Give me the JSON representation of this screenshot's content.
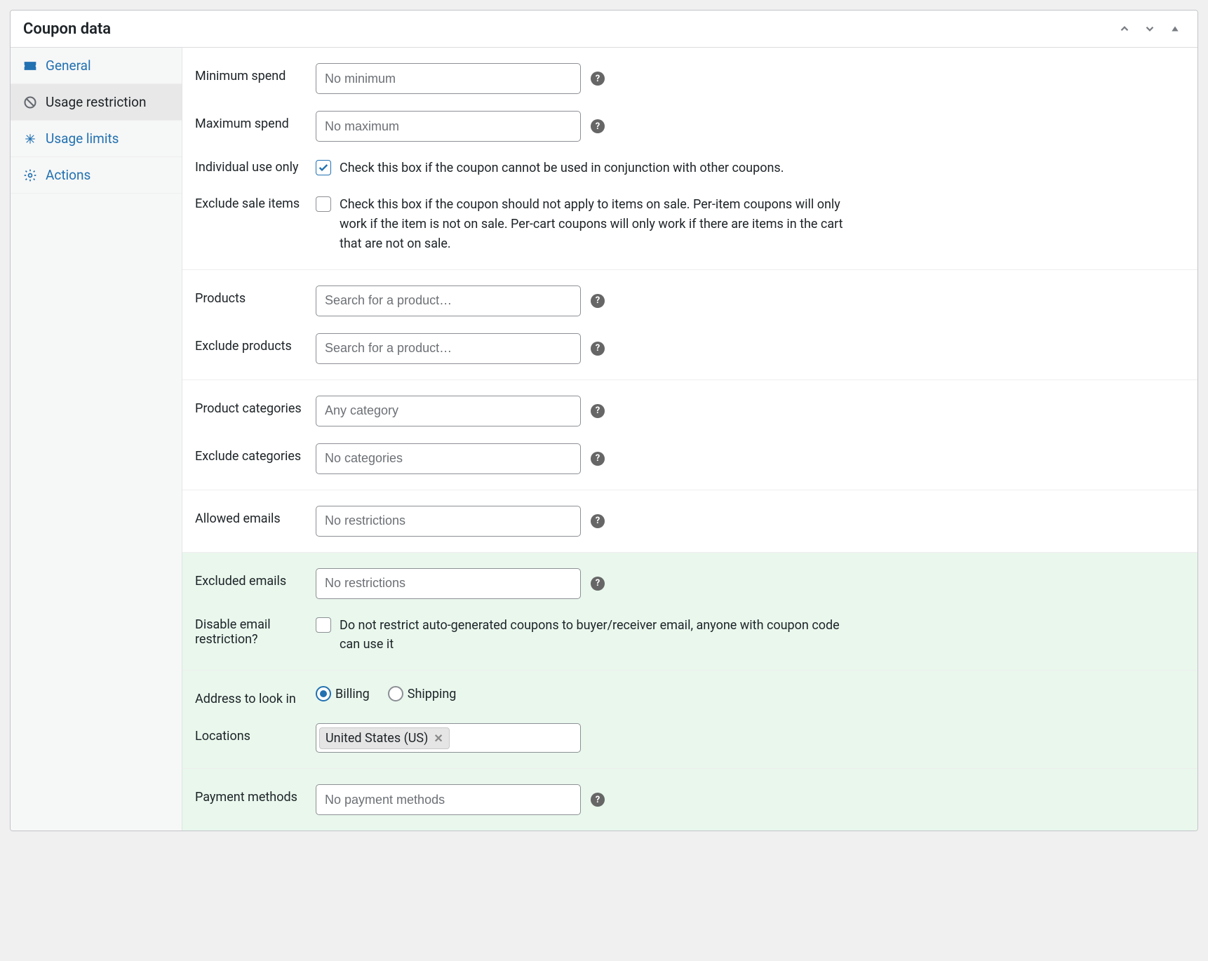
{
  "panel": {
    "title": "Coupon data"
  },
  "tabs": [
    {
      "id": "general",
      "label": "General",
      "icon": "ticket"
    },
    {
      "id": "usage_restriction",
      "label": "Usage restriction",
      "icon": "ban",
      "active": true
    },
    {
      "id": "usage_limits",
      "label": "Usage limits",
      "icon": "asterisk"
    },
    {
      "id": "actions",
      "label": "Actions",
      "icon": "gear"
    }
  ],
  "fields": {
    "minimum_spend": {
      "label": "Minimum spend",
      "placeholder": "No minimum"
    },
    "maximum_spend": {
      "label": "Maximum spend",
      "placeholder": "No maximum"
    },
    "individual_use": {
      "label": "Individual use only",
      "checked": true,
      "desc": "Check this box if the coupon cannot be used in conjunction with other coupons."
    },
    "exclude_sale_items": {
      "label": "Exclude sale items",
      "checked": false,
      "desc": "Check this box if the coupon should not apply to items on sale. Per-item coupons will only work if the item is not on sale. Per-cart coupons will only work if there are items in the cart that are not on sale."
    },
    "products": {
      "label": "Products",
      "placeholder": "Search for a product…"
    },
    "exclude_products": {
      "label": "Exclude products",
      "placeholder": "Search for a product…"
    },
    "product_categories": {
      "label": "Product categories",
      "placeholder": "Any category"
    },
    "exclude_categories": {
      "label": "Exclude categories",
      "placeholder": "No categories"
    },
    "allowed_emails": {
      "label": "Allowed emails",
      "placeholder": "No restrictions"
    },
    "excluded_emails": {
      "label": "Excluded emails",
      "placeholder": "No restrictions"
    },
    "disable_email_restriction": {
      "label": "Disable email restriction?",
      "checked": false,
      "desc": "Do not restrict auto-generated coupons to buyer/receiver email, anyone with coupon code can use it"
    },
    "address_to_look_in": {
      "label": "Address to look in",
      "options": {
        "billing": "Billing",
        "shipping": "Shipping"
      },
      "selected": "billing"
    },
    "locations": {
      "label": "Locations",
      "tags": [
        "United States (US)"
      ]
    },
    "payment_methods": {
      "label": "Payment methods",
      "placeholder": "No payment methods"
    }
  }
}
